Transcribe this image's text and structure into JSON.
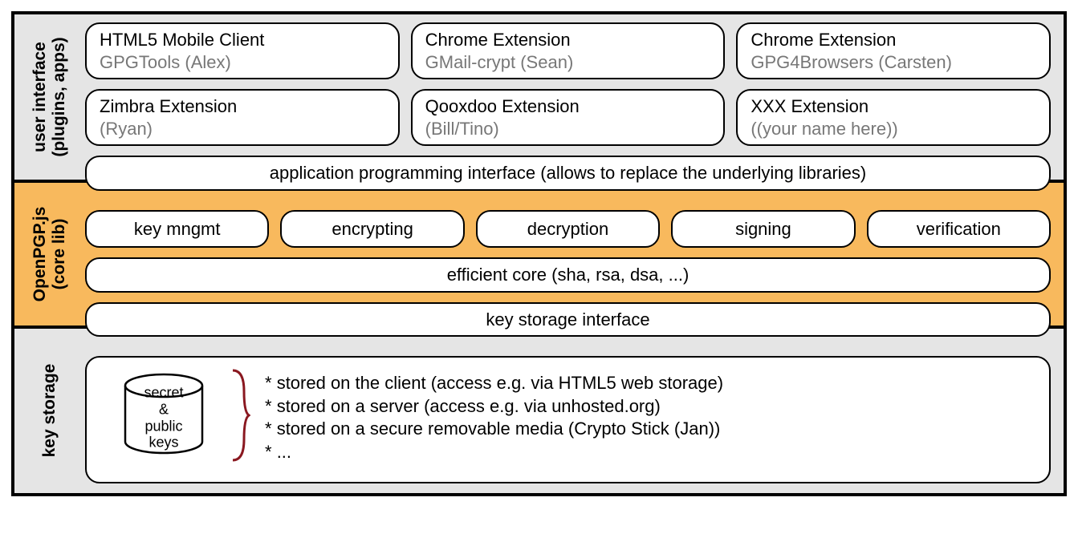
{
  "ui_layer": {
    "label_line1": "user interface",
    "label_line2": "(plugins, apps)",
    "row1": [
      {
        "title": "HTML5 Mobile Client",
        "sub": "GPGTools (Alex)"
      },
      {
        "title": "Chrome Extension",
        "sub": "GMail-crypt (Sean)"
      },
      {
        "title": "Chrome Extension",
        "sub": "GPG4Browsers (Carsten)"
      }
    ],
    "row2": [
      {
        "title": "Zimbra Extension",
        "sub": "(Ryan)"
      },
      {
        "title": "Qooxdoo Extension",
        "sub": "(Bill/Tino)"
      },
      {
        "title": "XXX Extension",
        "sub": "((your name here))"
      }
    ],
    "api_bar": "application programming interface (allows to replace the underlying libraries)"
  },
  "core_layer": {
    "label_line1": "OpenPGP.js",
    "label_line2": "(core lib)",
    "ops": [
      "key mngmt",
      "encrypting",
      "decryption",
      "signing",
      "verification"
    ],
    "core_bar": "efficient core (sha, rsa, dsa, ...)",
    "ks_interface": "key storage interface"
  },
  "ks_layer": {
    "label": "key storage",
    "db_line1": "secret &",
    "db_line2": "public",
    "db_line3": "keys",
    "bullets": [
      "stored on the client (access e.g. via HTML5  web storage)",
      "stored on a server (access e.g. via unhosted.org)",
      "stored on a secure removable media (Crypto Stick (Jan))",
      "..."
    ]
  }
}
